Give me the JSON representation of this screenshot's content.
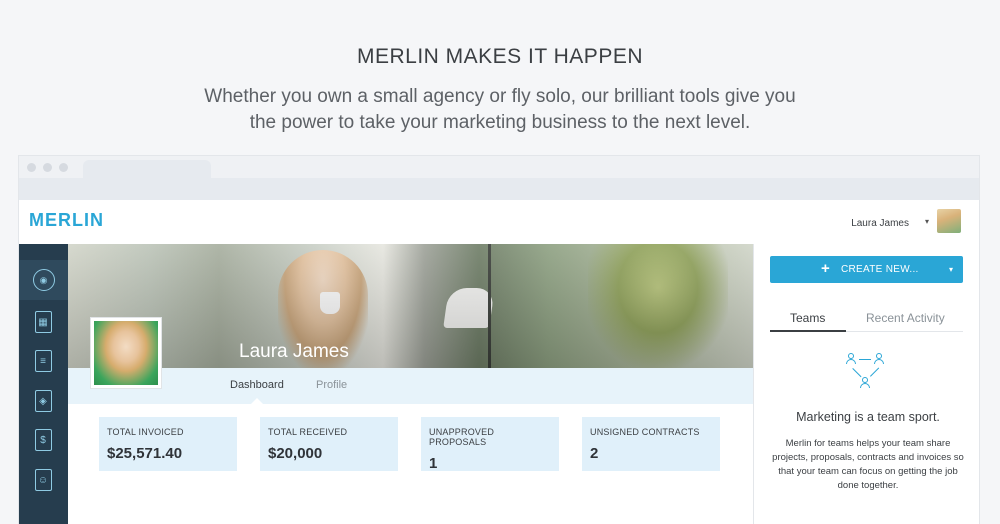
{
  "hero": {
    "title": "MERLIN MAKES IT HAPPEN",
    "subtitle_line1": "Whether you own a small agency or fly solo, our brilliant tools give you",
    "subtitle_line2": "the power to take your marketing business to the next level."
  },
  "app": {
    "logo": "MERLIN",
    "user_name": "Laura James",
    "user_caret": "▾"
  },
  "sidebar": {
    "items": [
      {
        "icon": "dashboard-icon",
        "glyph": "◉"
      },
      {
        "icon": "projects-icon",
        "glyph": "▦"
      },
      {
        "icon": "documents-icon",
        "glyph": "≡"
      },
      {
        "icon": "proposals-icon",
        "glyph": "◈"
      },
      {
        "icon": "invoices-icon",
        "glyph": "$"
      },
      {
        "icon": "contacts-icon",
        "glyph": "☺"
      }
    ]
  },
  "profile": {
    "name": "Laura James",
    "tabs": [
      "Dashboard",
      "Profile"
    ]
  },
  "stats": [
    {
      "label": "TOTAL INVOICED",
      "value": "$25,571.40"
    },
    {
      "label": "TOTAL RECEIVED",
      "value": "$20,000"
    },
    {
      "label": "UNAPPROVED PROPOSALS",
      "value": "1"
    },
    {
      "label": "UNSIGNED CONTRACTS",
      "value": "2"
    }
  ],
  "right_panel": {
    "create_label": "CREATE NEW...",
    "create_plus": "+",
    "create_caret": "▾",
    "tabs": [
      "Teams",
      "Recent Activity"
    ],
    "title": "Marketing is a team sport.",
    "body": "Merlin for teams helps your team share projects, proposals, contracts and invoices so that your team can focus on getting the job done together."
  },
  "colors": {
    "accent": "#2aa6d6",
    "sidebar_bg": "#263d4e",
    "stat_bg": "#e0f0fa"
  }
}
